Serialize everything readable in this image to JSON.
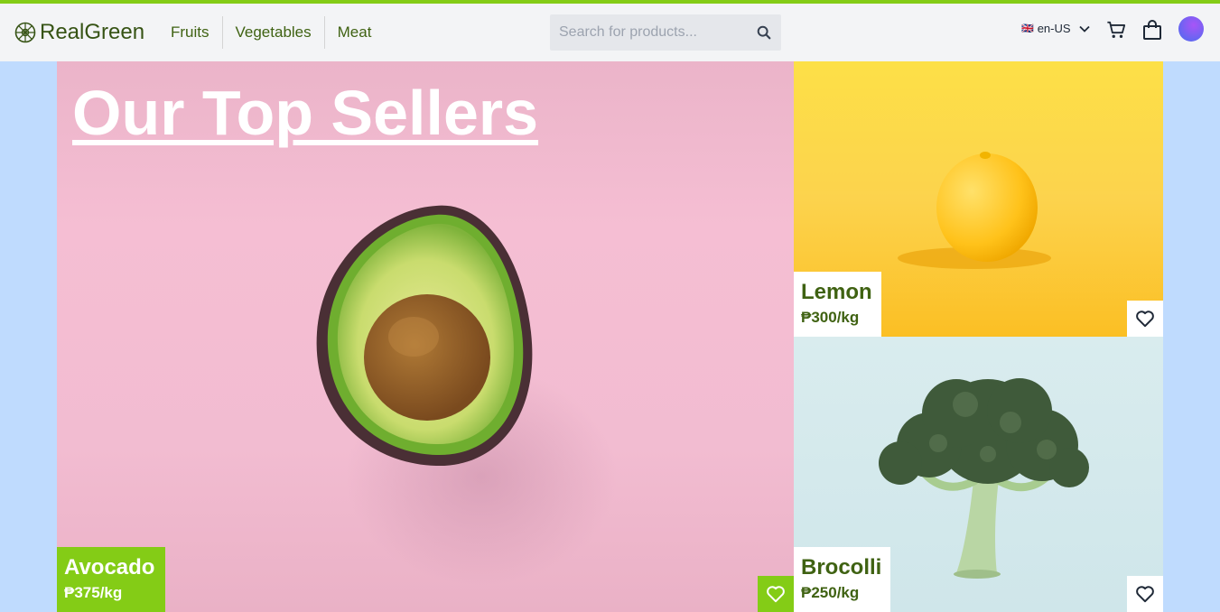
{
  "brand": {
    "name": "RealGreen",
    "accent": "#84cc16",
    "text_color": "#365314"
  },
  "nav": {
    "items": [
      "Fruits",
      "Vegetables",
      "Meat"
    ]
  },
  "search": {
    "placeholder": "Search for products...",
    "value": ""
  },
  "locale": {
    "flag": "🇬🇧",
    "label": "en-US"
  },
  "icons": {
    "logo": "leaf-logo-icon",
    "search": "search-icon",
    "dropdown": "chevron-down-icon",
    "cart": "cart-icon",
    "bag": "shopping-bag-icon",
    "favorite": "heart-icon"
  },
  "hero": {
    "title": "Our Top Sellers"
  },
  "products": [
    {
      "name": "Avocado",
      "price": "₱375/kg"
    },
    {
      "name": "Lemon",
      "price": "₱300/kg"
    },
    {
      "name": "Brocolli",
      "price": "₱250/kg"
    }
  ]
}
